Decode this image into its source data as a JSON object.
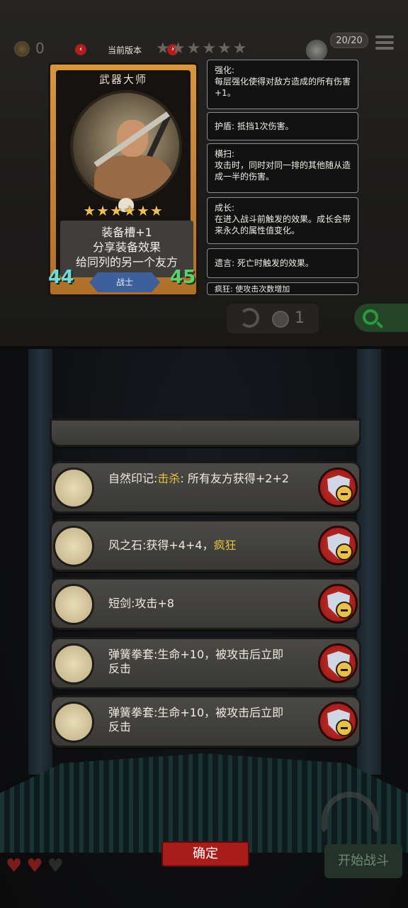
{
  "header": {
    "coins": "0",
    "version_label": "当前版本",
    "prev_icon": "chevron-left-icon",
    "next_icon": "chevron-right-icon",
    "version_stars": 6,
    "capacity": "20/20"
  },
  "hero_card": {
    "name": "武器大师",
    "stars": 6,
    "desc_lines": [
      "装备槽+1",
      "分享装备效果",
      "给同列的另一个友方"
    ],
    "attack": "44",
    "health": "45",
    "class": "战士"
  },
  "keywords": [
    {
      "title": "强化:",
      "text": "每层强化使得对敌方造成的所有伤害+1。"
    },
    {
      "title": "",
      "text": "护盾: 抵挡1次伤害。"
    },
    {
      "title": "横扫:",
      "text": "攻击时，同时对同一排的其他随从造成一半的伤害。"
    },
    {
      "title": "成长:",
      "text": "在进入战斗前触发的效果。成长会带来永久的属性值变化。"
    },
    {
      "title": "",
      "text": "遗言: 死亡时触发的效果。"
    },
    {
      "title": "",
      "text": "疯狂: 使攻击次数增加"
    }
  ],
  "bottom_bar": {
    "token_count": "1"
  },
  "items": [
    {
      "pre": "自然印记:",
      "hl": "击杀",
      "post": ": 所有友方获得+2+2",
      "icon": "nature-mark-icon"
    },
    {
      "pre": "风之石:获得+4+4，",
      "hl": "疯狂",
      "post": "",
      "icon": "wind-stone-icon"
    },
    {
      "pre": "短剑:攻击+8",
      "hl": "",
      "post": "",
      "icon": "short-sword-icon"
    },
    {
      "pre": "弹簧拳套:生命+10，被攻击后立即反击",
      "hl": "",
      "post": "",
      "icon": "spring-glove-icon"
    },
    {
      "pre": "弹簧拳套:生命+10，被攻击后立即反击",
      "hl": "",
      "post": "",
      "icon": "spring-glove-icon"
    }
  ],
  "buttons": {
    "confirm": "确定",
    "start_battle": "开始战斗"
  },
  "lives": {
    "filled": 2,
    "total": 3
  },
  "colors": {
    "accent_red": "#a81c1a",
    "highlight_yellow": "#e8c23e",
    "attack_cyan": "#72dbd3",
    "health_green": "#62cf6e",
    "class_blue": "#3d5f9a"
  }
}
